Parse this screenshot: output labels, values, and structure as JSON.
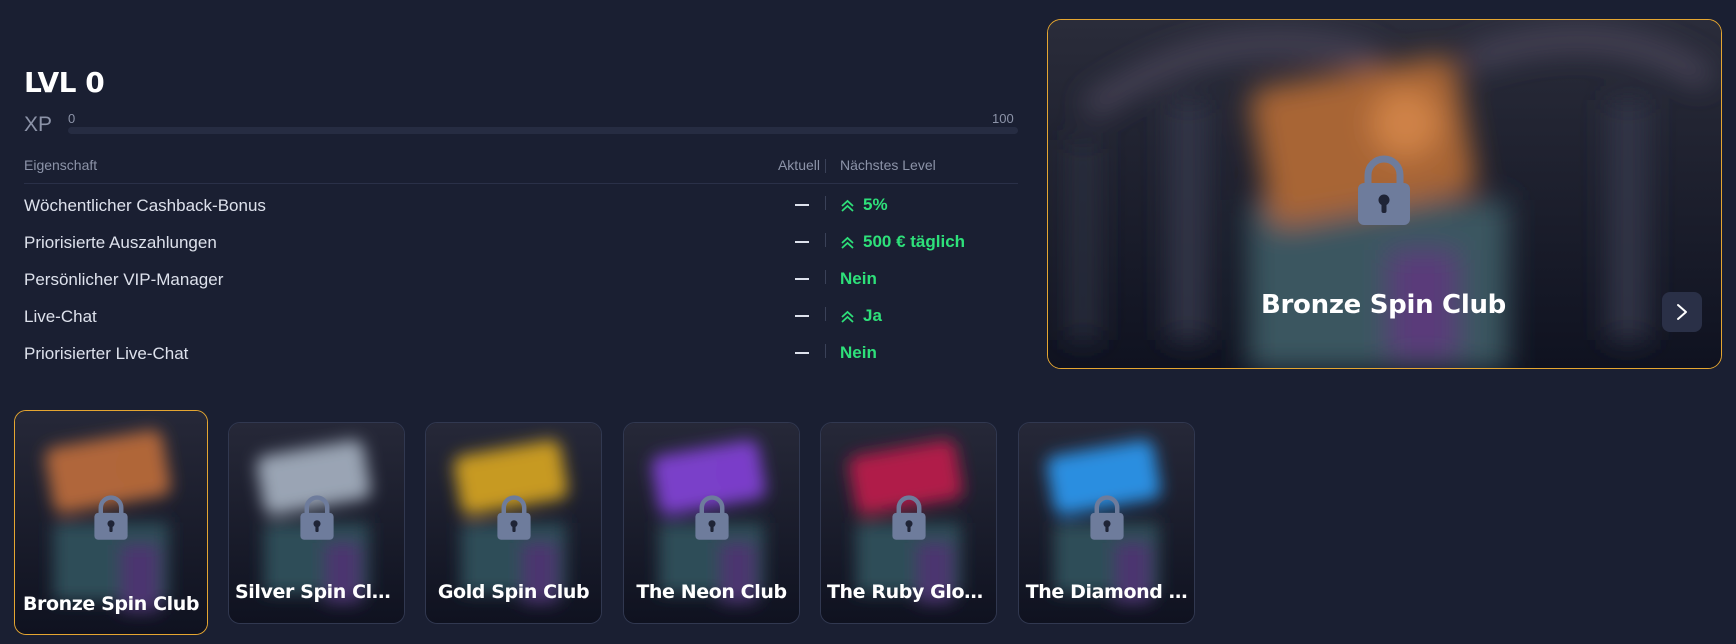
{
  "level": {
    "title": "LVL 0"
  },
  "xp": {
    "label": "XP",
    "min": "0",
    "max": "100",
    "progress": 0
  },
  "table": {
    "headers": {
      "property": "Eigenschaft",
      "current": "Aktuell",
      "next": "Nächstes Level"
    },
    "rows": [
      {
        "label": "Wöchentlicher Cashback-Bonus",
        "current": "—",
        "next": "5%",
        "arrow": true
      },
      {
        "label": "Priorisierte Auszahlungen",
        "current": "—",
        "next": "500 € täglich",
        "arrow": true
      },
      {
        "label": "Persönlicher VIP-Manager",
        "current": "—",
        "next": "Nein",
        "arrow": false
      },
      {
        "label": "Live-Chat",
        "current": "—",
        "next": "Ja",
        "arrow": true
      },
      {
        "label": "Priorisierter Live-Chat",
        "current": "—",
        "next": "Nein",
        "arrow": false
      }
    ]
  },
  "feature": {
    "name": "Bronze Spin Club",
    "icon": "lock-icon",
    "next_icon": "chevron-right-icon"
  },
  "tiers": [
    {
      "name": "Bronze Spin Club",
      "color": "#b0663a",
      "selected": true
    },
    {
      "name": "Silver Spin Club",
      "color": "#9aa4b4",
      "selected": false
    },
    {
      "name": "Gold Spin Club",
      "color": "#c79a22",
      "selected": false
    },
    {
      "name": "The Neon Club",
      "color": "#7a3fc9",
      "selected": false
    },
    {
      "name": "The Ruby Glow…",
      "color": "#b01d4a",
      "selected": false
    },
    {
      "name": "The Diamond …",
      "color": "#2a8ee0",
      "selected": false
    }
  ],
  "colors": {
    "accent": "#e5a631",
    "positive": "#2ee07a",
    "background": "#1a1f32"
  }
}
